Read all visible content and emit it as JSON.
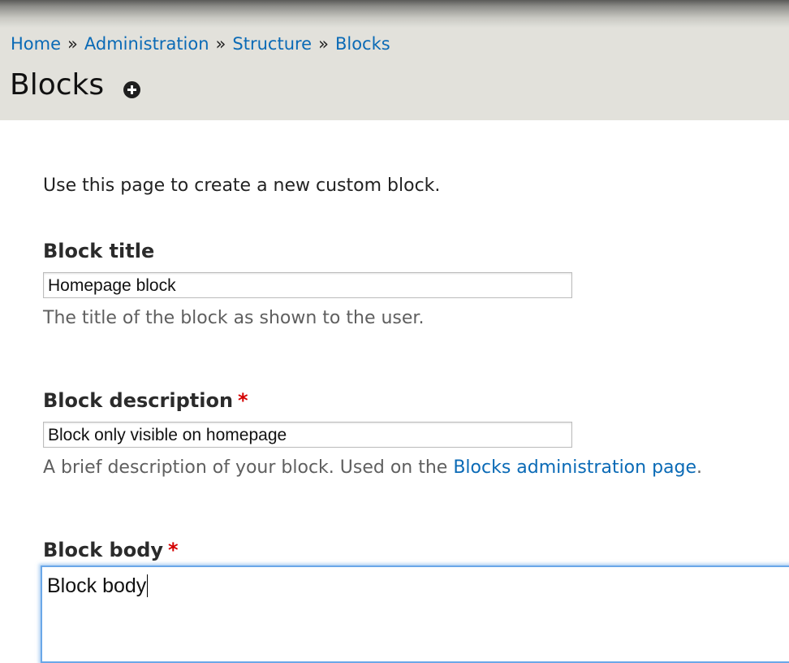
{
  "header": {
    "breadcrumb": [
      {
        "label": "Home"
      },
      {
        "label": "Administration"
      },
      {
        "label": "Structure"
      },
      {
        "label": "Blocks"
      }
    ],
    "separator": "»",
    "title": "Blocks",
    "add_icon": "plus-circle-icon"
  },
  "form": {
    "intro": "Use this page to create a new custom block.",
    "block_title": {
      "label": "Block title",
      "value": "Homepage block",
      "description": "The title of the block as shown to the user."
    },
    "block_description": {
      "label": "Block description",
      "required_marker": "*",
      "value": "Block only visible on homepage",
      "description_prefix": "A brief description of your block. Used on the ",
      "description_link": "Blocks administration page",
      "description_suffix": "."
    },
    "block_body": {
      "label": "Block body",
      "required_marker": "*",
      "value": "Block body"
    }
  },
  "colors": {
    "link": "#0a6ab6",
    "required": "#d40000",
    "focus": "#6aa7e8",
    "header_bg": "#e2e1db"
  }
}
